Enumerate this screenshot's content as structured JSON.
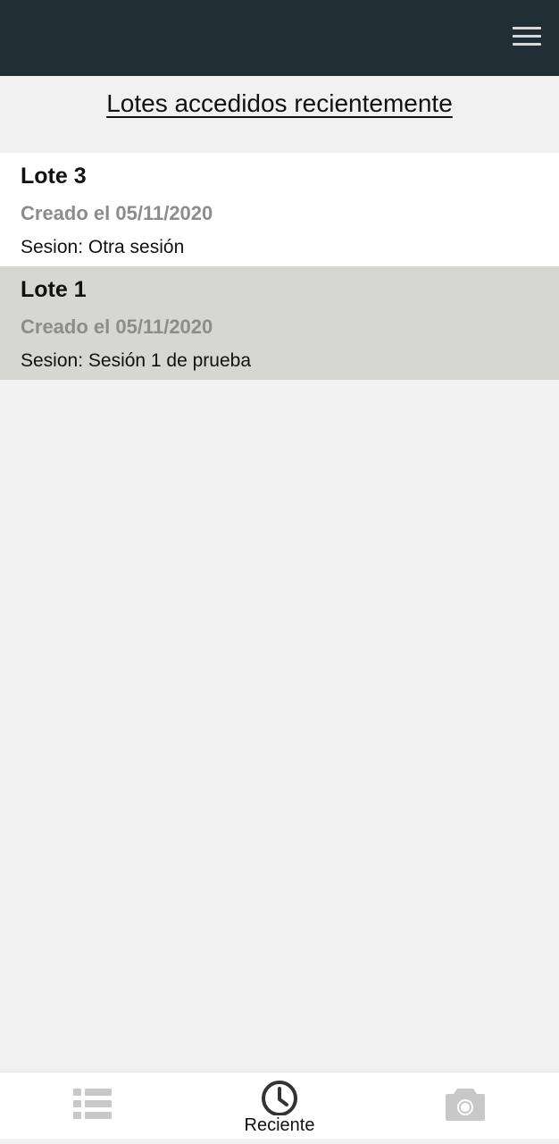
{
  "header": {
    "menu_icon": "hamburger-menu-icon",
    "bar_color": "#212e35"
  },
  "page": {
    "title": "Lotes accedidos recientemente"
  },
  "lots": [
    {
      "name": "Lote 3",
      "created": "Creado el 05/11/2020",
      "session": "Sesion: Otra sesión"
    },
    {
      "name": "Lote 1",
      "created": "Creado el 05/11/2020",
      "session": "Sesion: Sesión 1 de prueba"
    }
  ],
  "bottom_nav": {
    "items": [
      {
        "icon": "list-icon",
        "label": "",
        "active": false
      },
      {
        "icon": "clock-icon",
        "label": "Reciente",
        "active": true
      },
      {
        "icon": "camera-icon",
        "label": "",
        "active": false
      }
    ]
  }
}
